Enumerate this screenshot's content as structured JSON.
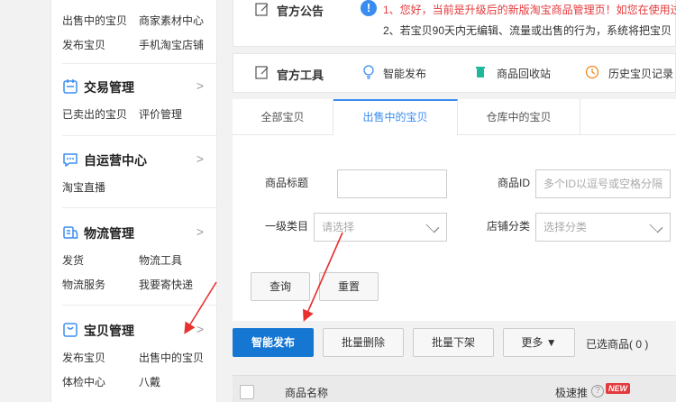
{
  "sidebar": {
    "top_links": [
      "出售中的宝贝",
      "商家素材中心",
      "发布宝贝",
      "手机淘宝店铺"
    ],
    "sections": [
      {
        "title": "交易管理",
        "links": [
          "已卖出的宝贝",
          "评价管理"
        ]
      },
      {
        "title": "自运营中心",
        "links": [
          "淘宝直播"
        ]
      },
      {
        "title": "物流管理",
        "links": [
          "发货",
          "物流工具",
          "物流服务",
          "我要寄快递"
        ]
      },
      {
        "title": "宝贝管理",
        "links": [
          "发布宝贝",
          "出售中的宝贝",
          "体检中心",
          "八戴"
        ]
      }
    ],
    "chevron": ">"
  },
  "announcement": {
    "title": "官方公告",
    "warn_icon": "!",
    "line1": "1、您好，当前是升级后的新版淘宝商品管理页！如您在使用过",
    "line2": "2、若宝贝90天内无编辑、流量或出售的行为，系统将把宝贝"
  },
  "tools": {
    "title": "官方工具",
    "items": [
      "智能发布",
      "商品回收站",
      "历史宝贝记录"
    ]
  },
  "tabs": [
    "全部宝贝",
    "出售中的宝贝",
    "仓库中的宝贝"
  ],
  "filters": {
    "title_label": "商品标题",
    "title_value": "",
    "id_label": "商品ID",
    "id_placeholder": "多个ID以逗号或空格分隔",
    "category_label": "一级类目",
    "category_placeholder": "请选择",
    "shop_category_label": "店铺分类",
    "shop_category_placeholder": "选择分类",
    "query_button": "查询",
    "reset_button": "重置"
  },
  "actions": {
    "smart_publish": "智能发布",
    "batch_delete": "批量删除",
    "batch_delist": "批量下架",
    "more": "更多",
    "more_caret": "▼",
    "selected_text": "已选商品( 0 )"
  },
  "table": {
    "col_name": "商品名称",
    "col_boost": "极速推",
    "help_icon": "?",
    "new_badge": "NEW"
  },
  "colors": {
    "primary": "#1677d2",
    "accent_blue": "#3a8df0",
    "warning_red": "#e4393c",
    "arrow_red": "#e8312f"
  }
}
